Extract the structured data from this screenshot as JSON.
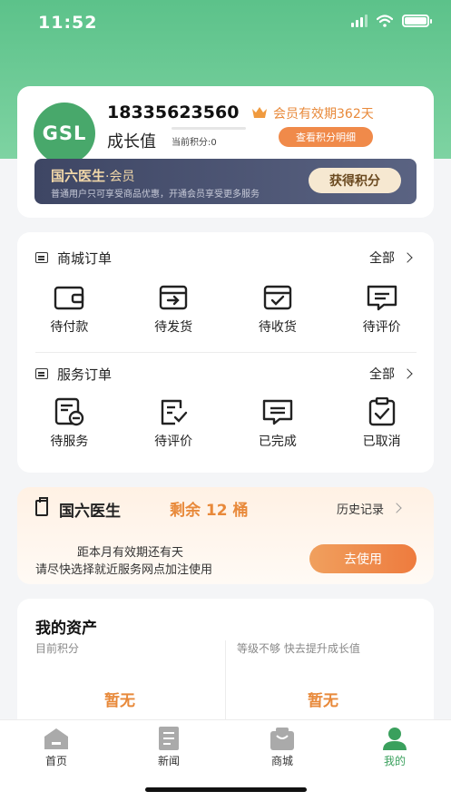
{
  "status_bar": {
    "time": "11:52"
  },
  "profile": {
    "avatar_text": "GSL",
    "phone": "18335623560",
    "member_valid": "会员有效期362天",
    "growth_label": "成长值",
    "current_points": "当前积分:0",
    "view_points_button": "查看积分明细",
    "vip_banner": {
      "title": "国六医生",
      "title_suffix": "·会员",
      "subtitle": "普通用户只可享受商品优惠，开通会员享受更多服务",
      "button": "获得积分"
    }
  },
  "mall_orders": {
    "title": "商城订单",
    "all": "全部",
    "items": [
      {
        "label": "待付款",
        "icon": "wallet-icon"
      },
      {
        "label": "待发货",
        "icon": "box-arrow-icon"
      },
      {
        "label": "待收货",
        "icon": "box-check-icon"
      },
      {
        "label": "待评价",
        "icon": "message-icon"
      }
    ]
  },
  "service_orders": {
    "title": "服务订单",
    "all": "全部",
    "items": [
      {
        "label": "待服务",
        "icon": "document-service-icon"
      },
      {
        "label": "待评价",
        "icon": "edit-check-icon"
      },
      {
        "label": "已完成",
        "icon": "chat-done-icon"
      },
      {
        "label": "已取消",
        "icon": "clipboard-check-icon"
      }
    ]
  },
  "doctor": {
    "title": "国六医生",
    "remaining": "剩余 12 桶",
    "history": "历史记录",
    "line1": "距本月有效期还有天",
    "line2": "请尽快选择就近服务网点加注使用",
    "use_button": "去使用"
  },
  "assets": {
    "title": "我的资产",
    "left_label": "目前积分",
    "left_value": "暂无",
    "right_label": "等级不够 快去提升成长值",
    "right_value": "暂无"
  },
  "tabbar": {
    "items": [
      {
        "label": "首页",
        "icon": "home-icon"
      },
      {
        "label": "新闻",
        "icon": "news-icon"
      },
      {
        "label": "商城",
        "icon": "shop-bag-icon"
      },
      {
        "label": "我的",
        "icon": "user-icon"
      }
    ],
    "active_index": 3
  },
  "colors": {
    "brand_green": "#5cc28a",
    "accent_orange": "#e8893a",
    "vip_dark": "#3e4664"
  }
}
